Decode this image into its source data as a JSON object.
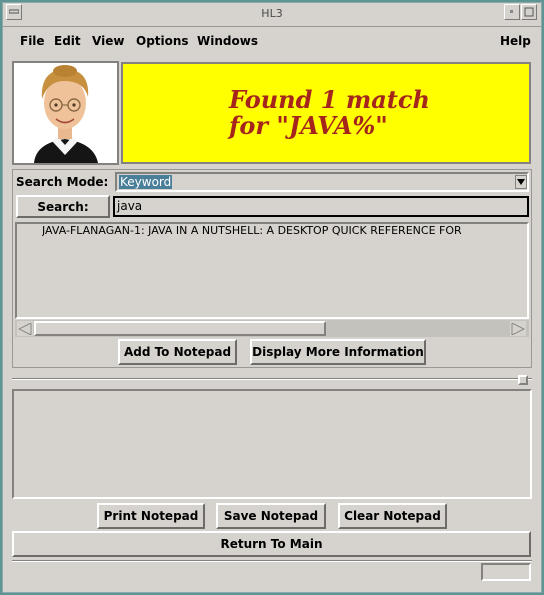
{
  "window": {
    "title": "HL3"
  },
  "menu": {
    "file": "File",
    "edit": "Edit",
    "view": "View",
    "options": "Options",
    "windows": "Windows",
    "help": "Help"
  },
  "banner": {
    "line1": "Found 1 match",
    "line2": "for \"JAVA%\""
  },
  "search": {
    "mode_label": "Search Mode:",
    "mode_value": "Keyword",
    "search_button": "Search:",
    "query": "java"
  },
  "results": [
    "JAVA-FLANAGAN-1: JAVA IN A NUTSHELL: A DESKTOP QUICK REFERENCE FOR"
  ],
  "actions": {
    "add_to_notepad": "Add To Notepad",
    "display_more": "Display More Information"
  },
  "notepad": {
    "print": "Print Notepad",
    "save": "Save Notepad",
    "clear": "Clear Notepad",
    "return": "Return To Main"
  },
  "colors": {
    "banner_bg": "#ffff00",
    "banner_text": "#a5241c",
    "selection": "#4a7f9a"
  }
}
